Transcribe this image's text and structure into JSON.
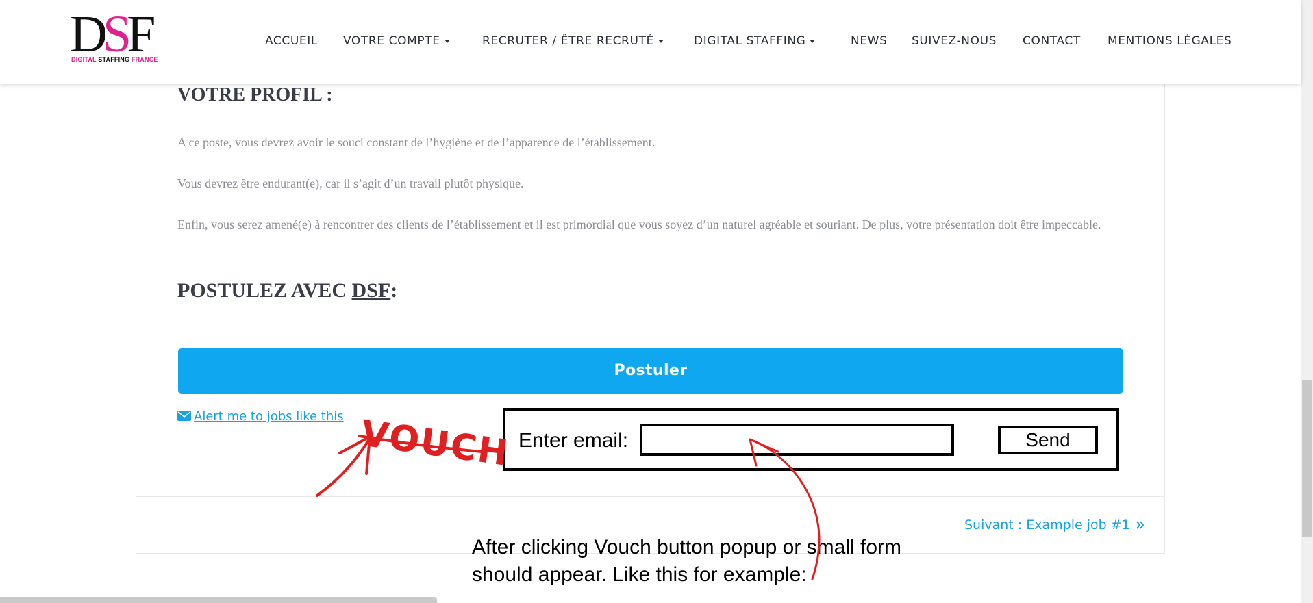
{
  "header": {
    "logo": {
      "mark": "DSF",
      "subtitle_part1": "DIGITAL ",
      "subtitle_part2": "STAFFING",
      "subtitle_part3": " FRANCE"
    },
    "nav": [
      {
        "label": "ACCUEIL"
      },
      {
        "label": "VOTRE COMPTE"
      },
      {
        "label": "RECRUTER / ÊTRE RECRUTÉ"
      },
      {
        "label": "DIGITAL STAFFING"
      },
      {
        "label": "NEWS"
      },
      {
        "label": "SUIVEZ-NOUS"
      },
      {
        "label": "CONTACT"
      },
      {
        "label": "MENTIONS LÉGALES"
      }
    ]
  },
  "content": {
    "profile_heading": "VOTRE PROFIL :",
    "paragraphs": [
      "A ce poste, vous devrez avoir le souci constant de l’hygiène et de l’apparence de l’établissement.",
      "Vous devrez être endurant(e), car il s’agit d’un travail plutôt physique.",
      "Enfin, vous serez amené(e) à rencontrer des clients de l’établissement et il est primordial que vous soyez d’un naturel agréable et souriant. De plus, votre présentation doit être impeccable."
    ],
    "apply_heading_prefix": "POSTULEZ AVEC ",
    "apply_heading_link": "DSF",
    "apply_heading_suffix": ":",
    "apply_button": "Postuler",
    "alert_link": "Alert me to jobs like this",
    "next_link": "Suivant : Example job #1"
  },
  "annotation": {
    "vouch_text": "VOUCH",
    "form_label": "Enter email:",
    "send_button": "Send",
    "note_line1": "After clicking Vouch button popup or small form",
    "note_line2": "should appear. Like this for example:"
  },
  "colors": {
    "accent": "#0ea7f0",
    "link": "#1aa1e0",
    "brand_pink": "#e0228e",
    "annotation_red": "#e02020"
  }
}
